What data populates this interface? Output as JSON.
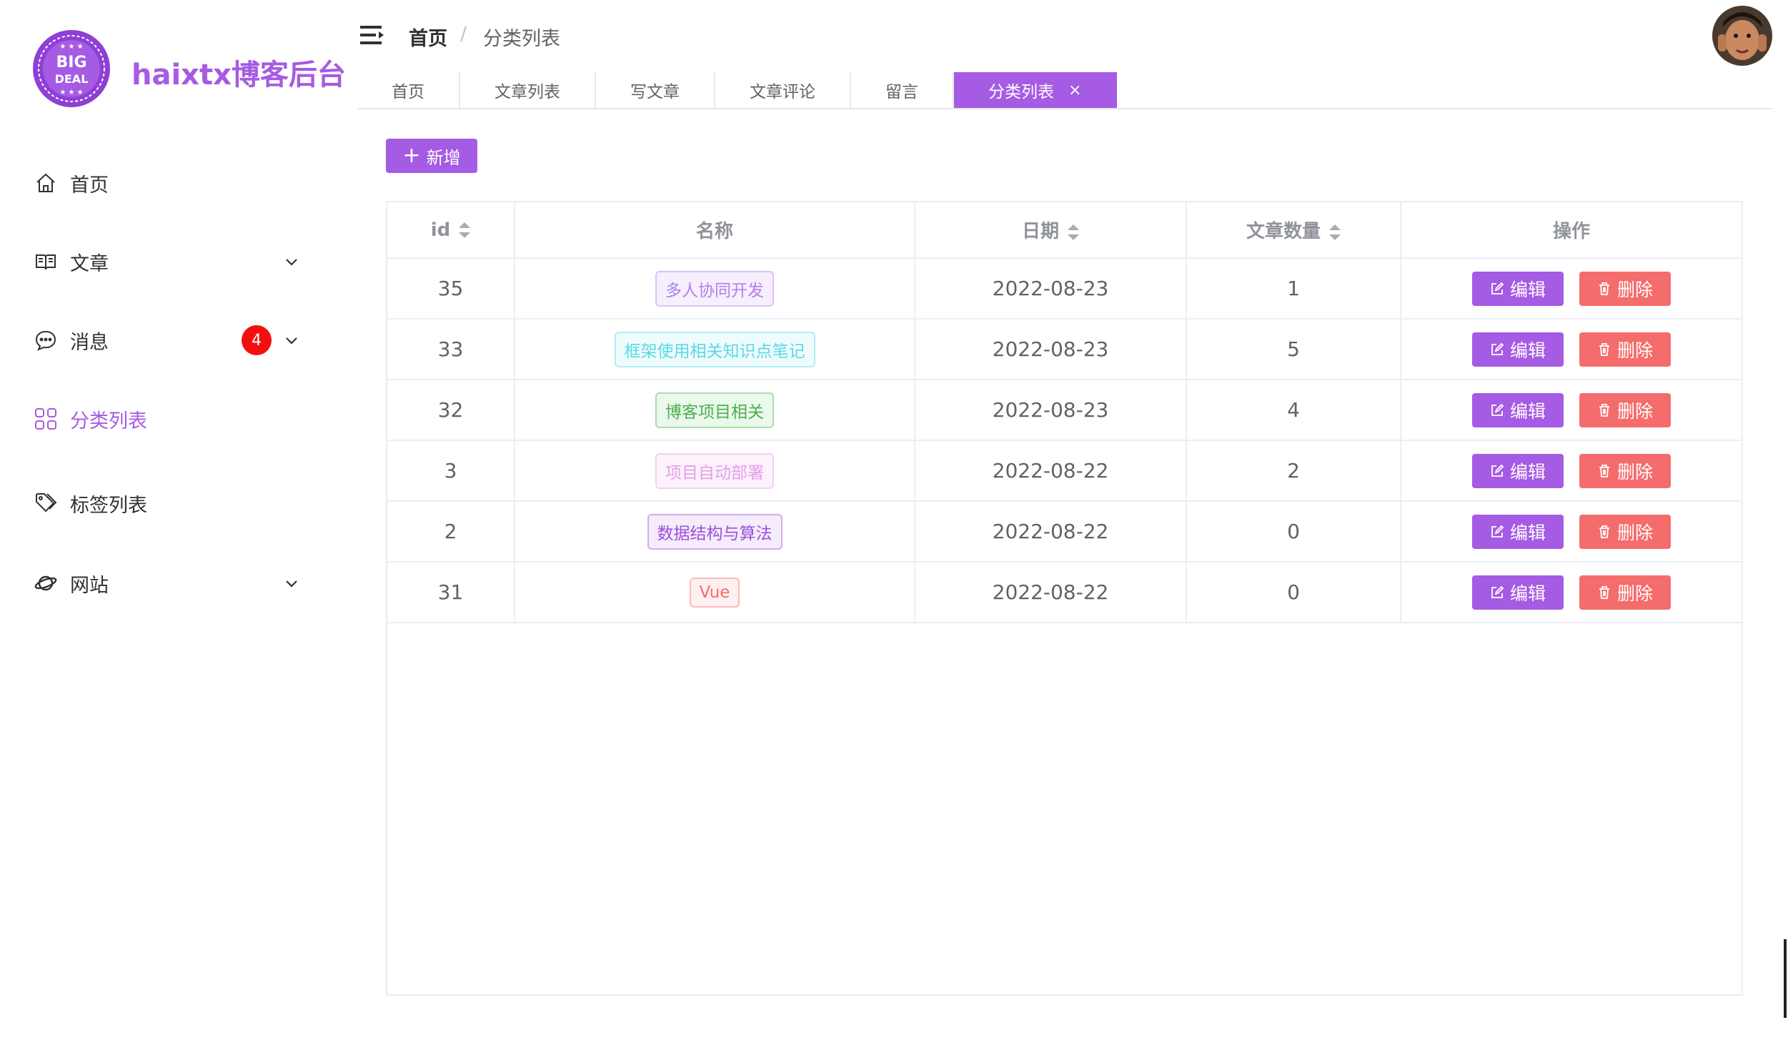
{
  "brand": {
    "logo_text_top": "BIG",
    "logo_text_bottom": "DEAL",
    "name": "haixtx博客后台"
  },
  "sidebar": {
    "items": [
      {
        "label": "首页",
        "icon": "home-icon"
      },
      {
        "label": "文章",
        "icon": "book-icon"
      },
      {
        "label": "消息",
        "icon": "chat-icon",
        "badge": "4"
      },
      {
        "label": "分类列表",
        "icon": "grid-icon",
        "active": true
      },
      {
        "label": "标签列表",
        "icon": "tag-icon"
      },
      {
        "label": "网站",
        "icon": "planet-icon"
      }
    ]
  },
  "header": {
    "breadcrumb_home": "首页",
    "breadcrumb_sep": "/",
    "breadcrumb_current": "分类列表"
  },
  "tabs": [
    {
      "label": "首页"
    },
    {
      "label": "文章列表"
    },
    {
      "label": "写文章"
    },
    {
      "label": "文章评论"
    },
    {
      "label": "留言"
    },
    {
      "label": "分类列表",
      "active": true,
      "close": "×"
    }
  ],
  "toolbar": {
    "add_label": "新增"
  },
  "table": {
    "columns": [
      "id",
      "名称",
      "日期",
      "文章数量",
      "操作"
    ],
    "edit_label": "编辑",
    "delete_label": "删除",
    "rows": [
      {
        "id": "35",
        "name": "多人协同开发",
        "date": "2022-08-23",
        "count": "1"
      },
      {
        "id": "33",
        "name": "框架使用相关知识点笔记",
        "date": "2022-08-23",
        "count": "5"
      },
      {
        "id": "32",
        "name": "博客项目相关",
        "date": "2022-08-23",
        "count": "4"
      },
      {
        "id": "3",
        "name": "项目自动部署",
        "date": "2022-08-22",
        "count": "2"
      },
      {
        "id": "2",
        "name": "数据结构与算法",
        "date": "2022-08-22",
        "count": "0"
      },
      {
        "id": "31",
        "name": "Vue",
        "date": "2022-08-22",
        "count": "0"
      }
    ]
  },
  "colors": {
    "accent": "#a55be3",
    "danger": "#f56c6c",
    "badge": "#f40f0f",
    "tag_colors": [
      "#b37feb",
      "#5bd8e6",
      "#4caf50",
      "#e59ee8",
      "#9c4fd8",
      "#f56c6c"
    ]
  }
}
